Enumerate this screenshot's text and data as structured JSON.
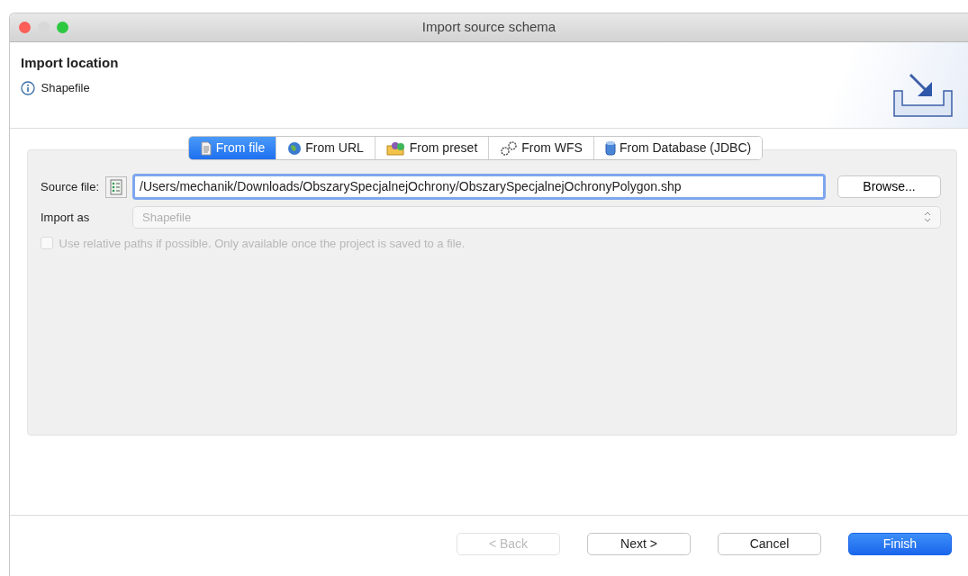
{
  "window": {
    "title": "Import source schema"
  },
  "header": {
    "title": "Import location",
    "message": "Shapefile"
  },
  "tabs": [
    {
      "label": "From file",
      "kind": "file",
      "selected": true
    },
    {
      "label": "From URL",
      "kind": "globe",
      "selected": false
    },
    {
      "label": "From preset",
      "kind": "folder",
      "selected": false
    },
    {
      "label": "From WFS",
      "kind": "gears",
      "selected": false
    },
    {
      "label": "From Database (JDBC)",
      "kind": "database",
      "selected": false
    }
  ],
  "source_file": {
    "label": "Source file:",
    "value": "/Users/mechanik/Downloads/ObszarySpecjalnejOchrony/ObszarySpecjalnejOchronyPolygon.shp",
    "browse": "Browse..."
  },
  "import_as": {
    "label": "Import as",
    "value": "Shapefile",
    "disabled": true
  },
  "relative_paths": {
    "label": "Use relative paths if possible. Only available once the project is saved to a file.",
    "checked": false,
    "disabled": true
  },
  "buttons": [
    {
      "label": "< Back",
      "disabled": true,
      "default": false
    },
    {
      "label": "Next >",
      "disabled": false,
      "default": false
    },
    {
      "label": "Cancel",
      "disabled": false,
      "default": false
    },
    {
      "label": "Finish",
      "disabled": false,
      "default": true
    }
  ]
}
